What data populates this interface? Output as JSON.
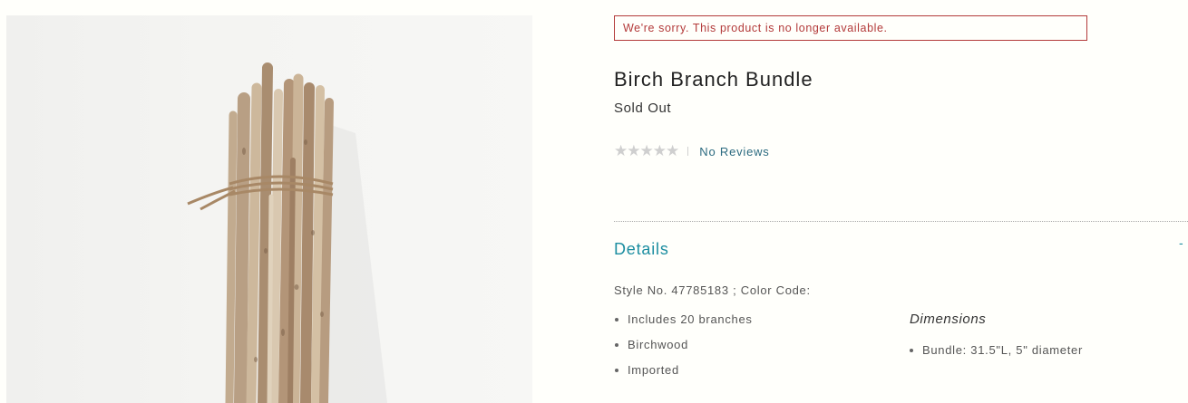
{
  "alert": {
    "text": "We're sorry. This product is no longer available."
  },
  "product": {
    "title": "Birch Branch Bundle",
    "status": "Sold Out",
    "rating": {
      "stars": 0,
      "max": 5,
      "reviews_label": "No Reviews"
    },
    "image_alt": "Bundle of birch branches tied with twine"
  },
  "details": {
    "heading": "Details",
    "toggle": "-",
    "style_line": "Style No. 47785183 ; Color Code:",
    "features": [
      "Includes 20 branches",
      "Birchwood",
      "Imported"
    ],
    "dimensions_heading": "Dimensions",
    "dimensions": [
      "Bundle: 31.5\"L, 5\" diameter"
    ]
  },
  "colors": {
    "accent": "#1d8ea1",
    "link": "#2c6b80",
    "alert": "#b33a3a",
    "star_empty": "#cfcfcf"
  },
  "icons": {
    "star": "star-icon"
  }
}
